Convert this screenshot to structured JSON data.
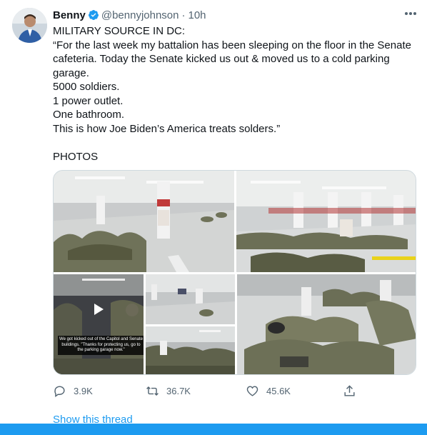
{
  "author": {
    "name": "Benny",
    "handle": "@bennyjohnson",
    "separator": "·",
    "time": "10h"
  },
  "tweet_lines": [
    "MILITARY SOURCE IN DC:",
    "“For the last week my battalion has been sleeping on the floor in the Senate cafeteria. Today the Senate kicked us out & moved us to a cold parking garage.",
    "5000 soldiers.",
    "1 power outlet.",
    "One bathroom.",
    "This is how Joe Biden’s America treats solders.”",
    "",
    "PHOTOS"
  ],
  "video_caption": "We got kicked out of the Capitol and Senate buildings. \"Thanks for protecting us, go to the parking garage now.\"",
  "actions": {
    "reply_count": "3.9K",
    "retweet_count": "36.7K",
    "like_count": "45.6K"
  },
  "show_thread": "Show this thread",
  "icons": {
    "verified": "verified-badge-icon",
    "more": "more-options-icon",
    "reply": "reply-icon",
    "retweet": "retweet-icon",
    "like": "like-icon",
    "share": "share-icon",
    "play": "play-icon"
  },
  "colors": {
    "accent": "#1d9bf0",
    "muted": "#536471",
    "text": "#0f1419"
  }
}
